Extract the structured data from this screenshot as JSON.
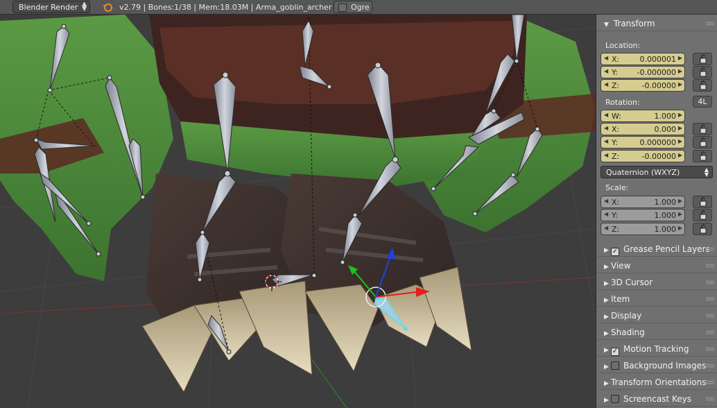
{
  "header": {
    "render_engine": "Blender Render",
    "stats": "v2.79 | Bones:1/38 | Mem:18.03M | Arma_goblin_archer",
    "ogre_label": "Ogre",
    "logo_icon": "blender-logo-icon"
  },
  "panel": {
    "transform_title": "Transform",
    "location_label": "Location:",
    "location": [
      {
        "axis": "X:",
        "value": "0.000001"
      },
      {
        "axis": "Y:",
        "value": "-0.000000"
      },
      {
        "axis": "Z:",
        "value": "-0.00000"
      }
    ],
    "rotation_label": "Rotation:",
    "rotation_4l": "4L",
    "rotation": [
      {
        "axis": "W:",
        "value": "1.000"
      },
      {
        "axis": "X:",
        "value": "0.000"
      },
      {
        "axis": "Y:",
        "value": "0.000000"
      },
      {
        "axis": "Z:",
        "value": "-0.00000"
      }
    ],
    "rotation_mode": "Quaternion (WXYZ)",
    "scale_label": "Scale:",
    "scale": [
      {
        "axis": "X:",
        "value": "1.000"
      },
      {
        "axis": "Y:",
        "value": "1.000"
      },
      {
        "axis": "Z:",
        "value": "1.000"
      }
    ],
    "sections": [
      {
        "label": "Grease Pencil Layers",
        "checkbox": true
      },
      {
        "label": "View",
        "checkbox": false
      },
      {
        "label": "3D Cursor",
        "checkbox": false
      },
      {
        "label": "Item",
        "checkbox": false
      },
      {
        "label": "Display",
        "checkbox": false
      },
      {
        "label": "Shading",
        "checkbox": false
      },
      {
        "label": "Motion Tracking",
        "checkbox": true
      },
      {
        "label": "Background Images",
        "checkbox": true
      },
      {
        "label": "Transform Orientations",
        "checkbox": false
      },
      {
        "label": "Screencast Keys",
        "checkbox": true
      }
    ]
  },
  "colors": {
    "field_active": "#d5cc8f",
    "field_inactive": "#9b9b9b",
    "panel_bg": "#707070",
    "header_bg": "#565656",
    "skin_green": "#4f8a3c",
    "armor_brown": "#4a2a22",
    "bone_grey": "#a9adb8",
    "gizmo_red": "#e02020",
    "gizmo_green": "#20c020",
    "gizmo_blue": "#2040e0"
  }
}
